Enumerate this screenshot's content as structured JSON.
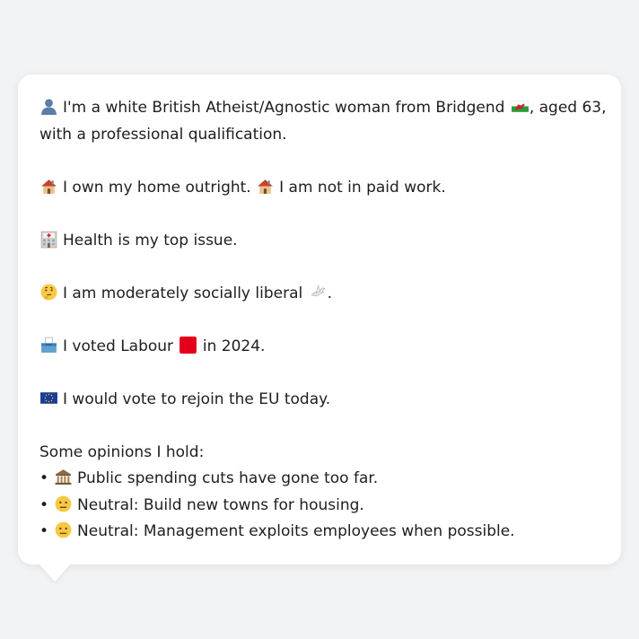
{
  "profile": {
    "intro_a": "I'm a white British Atheist/Agnostic woman from Bridgend",
    "intro_b": ", aged 63,",
    "intro_c": "with a professional qualification.",
    "home_a": "I own my home outright.",
    "home_b": "I am not in paid work.",
    "issue": "Health is my top issue.",
    "liberal": "I am moderately socially liberal",
    "liberal_end": ".",
    "vote_a": "I voted Labour",
    "vote_b": "in 2024.",
    "eu": "I would vote to rejoin the EU today.",
    "opinions_heading": "Some opinions I hold:",
    "opinions": [
      {
        "bullet": "•",
        "icon": "bank-icon",
        "text": "Public spending cuts have gone too far."
      },
      {
        "bullet": "•",
        "icon": "neutral-face-icon",
        "text": "Neutral: Build new towns for housing."
      },
      {
        "bullet": "•",
        "icon": "neutral-face-icon",
        "text": "Neutral: Management exploits employees when possible."
      }
    ]
  },
  "colors": {
    "background": "#f2f3f5",
    "card": "#ffffff",
    "text": "#1e1e1e",
    "labour_red": "#e4001b"
  }
}
